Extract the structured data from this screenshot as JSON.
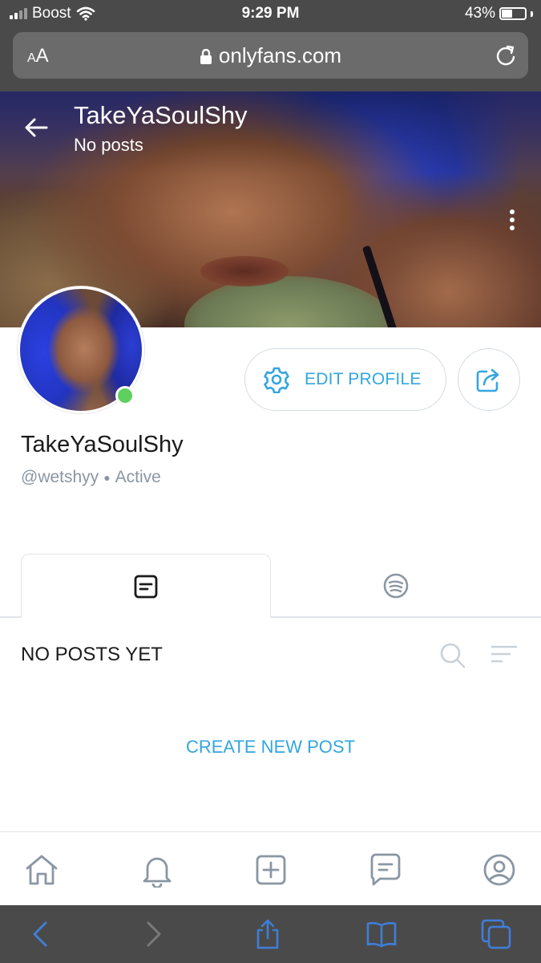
{
  "status_bar": {
    "carrier": "Boost",
    "time": "9:29 PM",
    "battery": "43%",
    "battery_level": 0.43
  },
  "browser": {
    "text_size_small": "A",
    "text_size_large": "A",
    "domain": "onlyfans.com"
  },
  "cover": {
    "title": "TakeYaSoulShy",
    "subtitle": "No posts"
  },
  "profile": {
    "name": "TakeYaSoulShy",
    "handle": "@wetshyy",
    "status": "Active"
  },
  "actions": {
    "edit_profile": "EDIT PROFILE"
  },
  "posts": {
    "section_title": "NO POSTS YET",
    "create_new_post": "CREATE NEW POST"
  },
  "colors": {
    "accent": "#33a6e0",
    "icon_gray": "#8a96a3",
    "online": "#5fcf5f",
    "safari_blue": "#3f7ed8"
  },
  "icons": {
    "back": "arrow-left-icon",
    "more": "more-vertical-icon",
    "settings": "gear-icon",
    "share": "share-icon",
    "posts_tab": "posts-icon",
    "media_tab": "audio-icon",
    "search": "search-icon",
    "sort": "sort-icon",
    "home": "home-icon",
    "notifications": "bell-icon",
    "add": "add-post-icon",
    "messages": "chat-icon",
    "profile": "profile-icon"
  }
}
